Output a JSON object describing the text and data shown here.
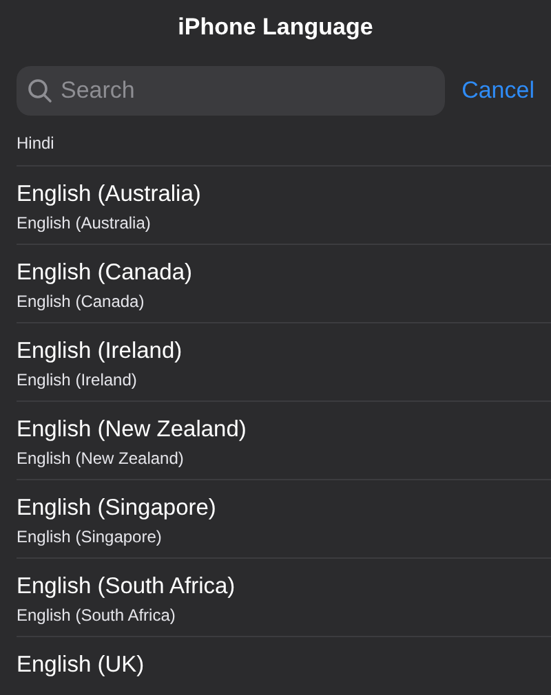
{
  "title": "iPhone Language",
  "search": {
    "placeholder": "Search"
  },
  "cancel": "Cancel",
  "partial_top": "Hindi",
  "languages": [
    {
      "name": "English (Australia)",
      "native": "English (Australia)"
    },
    {
      "name": "English (Canada)",
      "native": "English (Canada)"
    },
    {
      "name": "English (Ireland)",
      "native": "English (Ireland)"
    },
    {
      "name": "English (New Zealand)",
      "native": "English (New Zealand)"
    },
    {
      "name": "English (Singapore)",
      "native": "English (Singapore)"
    },
    {
      "name": "English (South Africa)",
      "native": "English (South Africa)"
    },
    {
      "name": "English (UK)"
    }
  ]
}
